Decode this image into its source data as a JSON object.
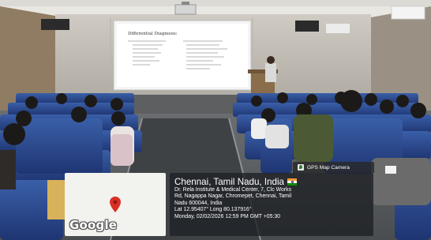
{
  "gps": {
    "badge_label": "GPS Map Camera",
    "title": "Chennai, Tamil Nadu, India",
    "address_lines": [
      "Dr. Rela Institute & Medical Center, 7, Clc Works",
      "Rd, Nagappa Nagar, Chromepet, Chennai, Tamil",
      "Nadu 600044, India"
    ],
    "coordinates": "Lat 12.95407° Long 80.137916°",
    "datetime": "Monday, 02/02/2026 12:59 PM GMT +05:30"
  },
  "map": {
    "logo_text": "Google"
  },
  "colors": {
    "flag_saffron": "#FF9933",
    "flag_white": "#FFFFFF",
    "flag_green": "#138808",
    "pin_red": "#d93025"
  }
}
